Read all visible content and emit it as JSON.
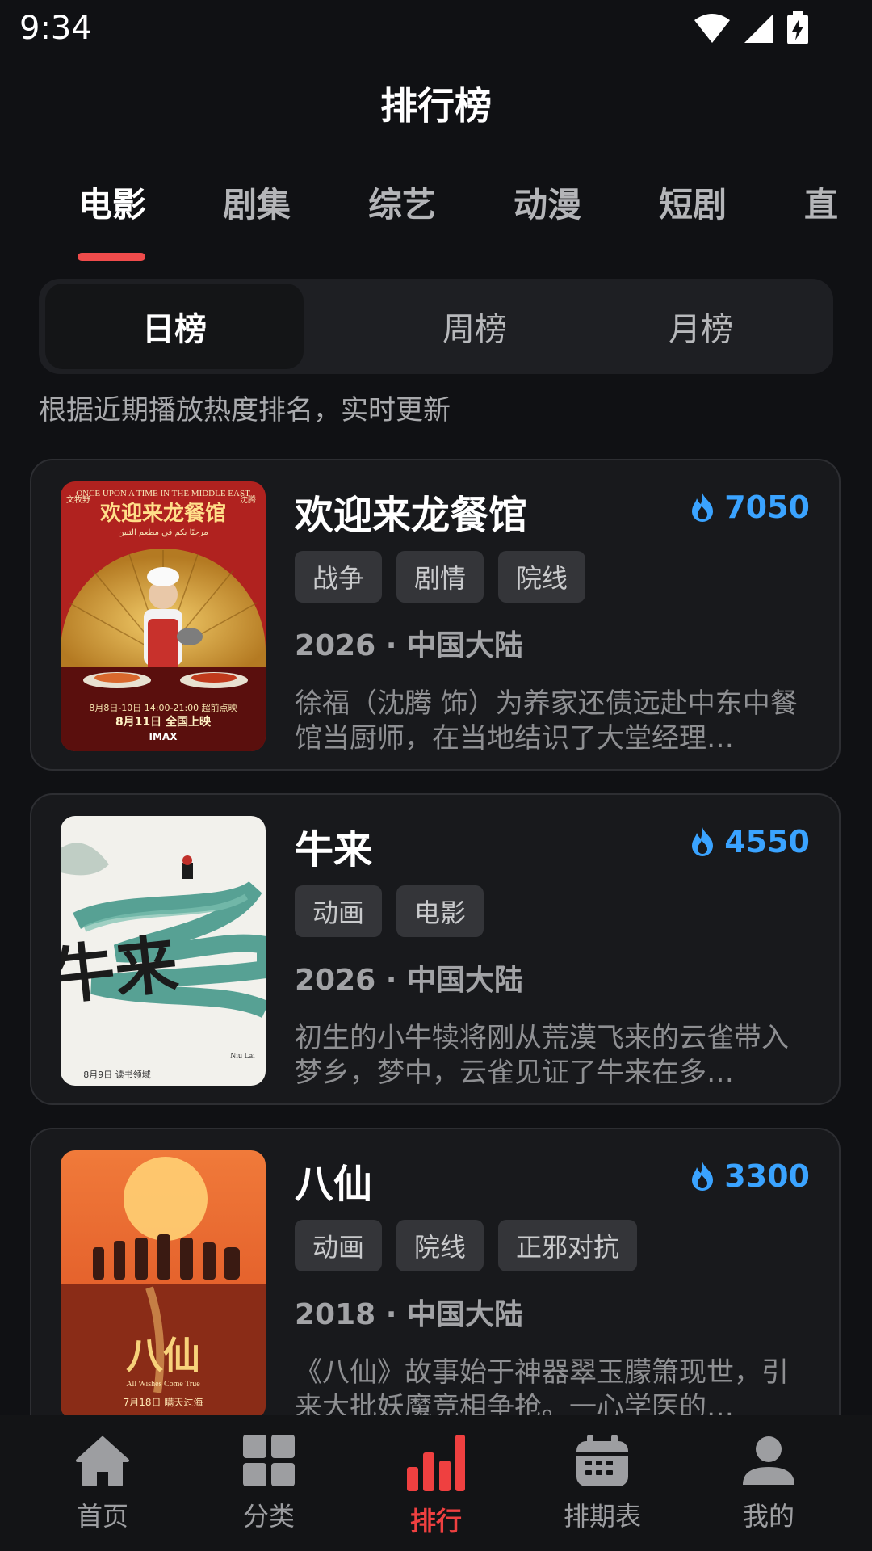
{
  "status_bar": {
    "time": "9:34"
  },
  "header": {
    "title": "排行榜"
  },
  "category_tabs": [
    {
      "label": "电影",
      "active": true
    },
    {
      "label": "剧集"
    },
    {
      "label": "综艺"
    },
    {
      "label": "动漫"
    },
    {
      "label": "短剧"
    },
    {
      "label": "直"
    }
  ],
  "period_tabs": [
    {
      "label": "日榜",
      "active": true
    },
    {
      "label": "周榜"
    },
    {
      "label": "月榜"
    }
  ],
  "hint": "根据近期播放热度排名，实时更新",
  "rankings": [
    {
      "title": "欢迎来龙餐馆",
      "heat": "7050",
      "tags": [
        "战争",
        "剧情",
        "院线"
      ],
      "meta": "2026 · 中国大陆",
      "description": "徐福（沈腾 饰）为养家还债远赴中东中餐馆当厨师，在当地结识了大堂经理…",
      "poster": {
        "top_text": "ONCE UPON A TIME IN THE MIDDLE EAST",
        "title_text": "欢迎来龙餐馆",
        "arabic_text": "مرحبًا بكم في مطعم التنين",
        "actor_left": "文牧野",
        "actor_right": "沈腾",
        "release_1": "8月8日-10日 14:00-21:00 超前点映",
        "release_2": "8月11日 全国上映",
        "format": "IMAX",
        "colors": {
          "bg": "#b0221f",
          "fan": "#d9a13d",
          "apron": "#c8312c"
        }
      }
    },
    {
      "title": "牛来",
      "heat": "4550",
      "tags": [
        "动画",
        "电影"
      ],
      "meta": "2026 · 中国大陆",
      "description": "初生的小牛犊将刚从荒漠飞来的云雀带入梦乡，梦中，云雀见证了牛来在多…",
      "poster": {
        "title_text": "牛来",
        "subtitle": "Niu Lai",
        "release": "8月9日 读书领域",
        "colors": {
          "bg": "#f2f1ec",
          "river": "#2f8d7e",
          "ink": "#1b1b1b"
        }
      }
    },
    {
      "title": "八仙",
      "heat": "3300",
      "tags": [
        "动画",
        "院线",
        "正邪对抗"
      ],
      "meta": "2018 · 中国大陆",
      "description": "《八仙》故事始于神器翠玉朦箫现世，引来大批妖魔竞相争抢。一心学医的…",
      "poster": {
        "title_text": "八仙",
        "tagline": "All Wishes Come True",
        "release": "7月18日 瞒天过海",
        "colors": {
          "sky": "#e4602b",
          "sun": "#ffcf73",
          "sea": "#8a2c17"
        }
      }
    }
  ],
  "bottom_nav": [
    {
      "label": "首页",
      "icon": "home-icon"
    },
    {
      "label": "分类",
      "icon": "grid-icon"
    },
    {
      "label": "排行",
      "icon": "bar-chart-icon",
      "active": true
    },
    {
      "label": "排期表",
      "icon": "calendar-icon"
    },
    {
      "label": "我的",
      "icon": "user-icon"
    }
  ],
  "colors": {
    "background": "#101114",
    "card": "#18191c",
    "accent_red": "#ef4b4b",
    "heat_blue": "#3aa3ff",
    "nav_active": "#ef4040"
  }
}
